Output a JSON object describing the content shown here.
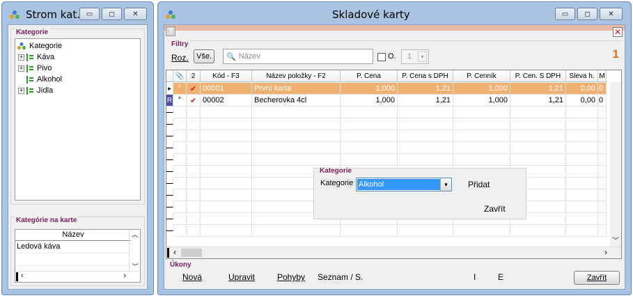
{
  "left_window": {
    "title": "Strom kat...",
    "kategorie_group_label": "Kategorie",
    "tree": [
      {
        "label": "Kategorie",
        "level": 0,
        "expander": ""
      },
      {
        "label": "Káva",
        "level": 1,
        "expander": "+"
      },
      {
        "label": "Pivo",
        "level": 1,
        "expander": "+"
      },
      {
        "label": "Alkohol",
        "level": 1,
        "expander": ""
      },
      {
        "label": "Jídla",
        "level": 1,
        "expander": "+"
      }
    ],
    "karte_group_label": "Kategórie na karte",
    "karte_column": "Název",
    "karte_items": [
      "Ledová káva"
    ]
  },
  "right_window": {
    "title": "Skladové karty",
    "filters_label": "Filtry",
    "roz_label": "Roz.",
    "vse_label": "Vše.",
    "search_placeholder": "Název",
    "o_label": "O.",
    "spin_value": "1",
    "counter": "1",
    "columns": [
      "",
      "",
      "2",
      "Kód - F3",
      "Název položky - F2",
      "P. Cena",
      "P. Cena s DPH",
      "P. Cenník",
      "P. Cen. S DPH",
      "Sleva h.",
      "M"
    ],
    "rows": [
      {
        "indicator": "▸",
        "flag": "°",
        "check": "✔",
        "kod": "00001",
        "nazev": "První karta",
        "p_cena": "1,000",
        "p_cena_dph": "1,21",
        "p_cennik": "1,000",
        "p_cen_dph": "1,21",
        "sleva": "0,00",
        "m": "0"
      },
      {
        "indicator": "R",
        "flag": "°",
        "check": "✔",
        "kod": "00002",
        "nazev": "Becherovka 4cl",
        "p_cena": "1,000",
        "p_cena_dph": "1,21",
        "p_cennik": "1,000",
        "p_cen_dph": "1,21",
        "sleva": "0,00",
        "m": "0"
      }
    ],
    "popup": {
      "group_label": "Kategorie",
      "field_label": "Kategorie",
      "selected_value": "Alkohol",
      "add_label": "Přidat",
      "close_label": "Zavřít"
    },
    "ukony_label": "Úkony",
    "actions": {
      "nova": "Nová",
      "upravit": "Upravit",
      "pohyby": "Pohyby",
      "seznam": "Seznam / S.",
      "i": "I",
      "e": "E",
      "zavrit": "Zavřít"
    }
  },
  "colors": {
    "window_frame": "#a9c4e2",
    "selected_row": "#f0b070",
    "group_label": "#7b1f5e",
    "counter": "#e07020",
    "combo_selection": "#3399ff"
  }
}
